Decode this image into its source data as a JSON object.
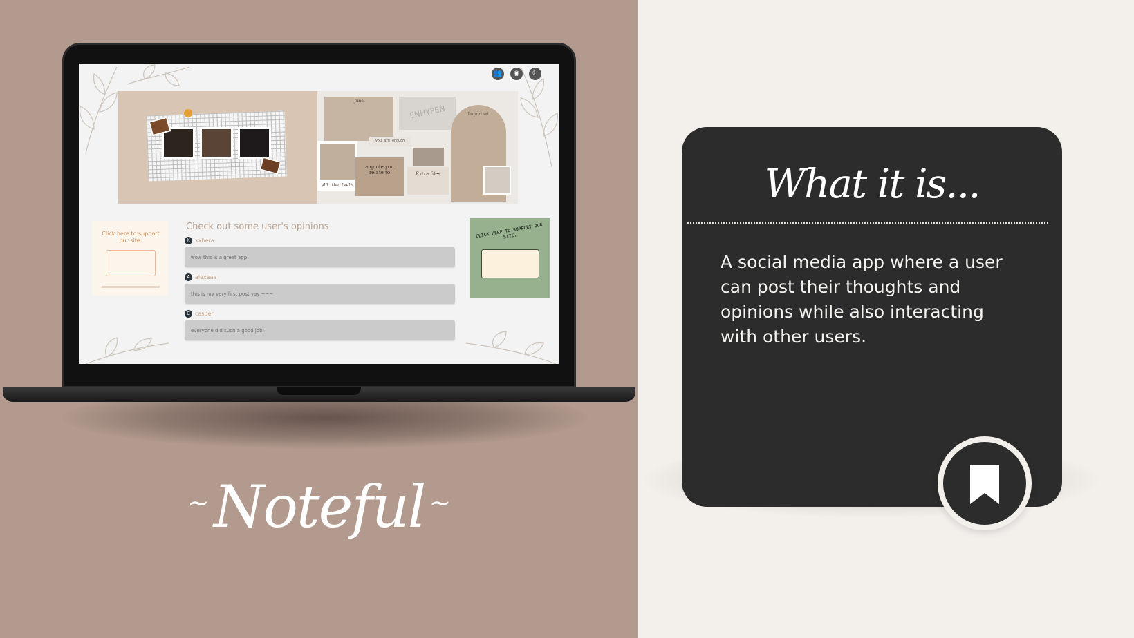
{
  "app_name": "Noteful",
  "app_title_decor": "~",
  "header_icons": [
    {
      "name": "users-icon",
      "glyph": "👥"
    },
    {
      "name": "github-icon",
      "glyph": "◉"
    },
    {
      "name": "moon-icon",
      "glyph": "☾"
    }
  ],
  "collage": {
    "calendar_month": "June",
    "brand_text": "ENHYPEN",
    "important_label": "Important",
    "quote_label": "a quote you relate to",
    "you_are_enough": "you are enough",
    "extra_files": "Extra files",
    "tag_label": "all the feels"
  },
  "support_left": {
    "title": "Click here to support our site."
  },
  "opinions": {
    "heading": "Check out some user's opinions",
    "posts": [
      {
        "initial": "X",
        "user": "xxhera",
        "text": "wow this is a great app!"
      },
      {
        "initial": "A",
        "user": "alexaaa",
        "text": "this is my very first post yay ~~~"
      },
      {
        "initial": "C",
        "user": "casper",
        "text": "everyone did such a good job!"
      }
    ]
  },
  "support_right": {
    "arc_text": "CLICK HERE TO SUPPORT OUR SITE."
  },
  "info_card": {
    "title": "What it is...",
    "description": "A social media app where a user can post their thoughts and opinions while also interacting with other users."
  },
  "colors": {
    "left_bg": "#b29a8e",
    "right_bg": "#f3f0ec",
    "card_bg": "#2c2c2c",
    "accent_beige": "#d9c5b3",
    "accent_green": "#97b18f"
  }
}
